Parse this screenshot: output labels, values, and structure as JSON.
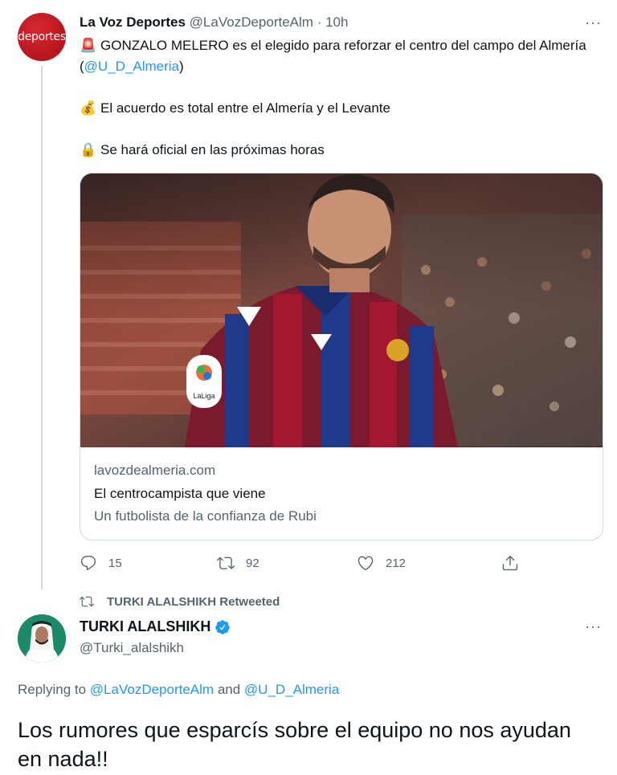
{
  "tweet1": {
    "avatar_text": "deportes",
    "name": "La Voz Deportes",
    "handle": "@LaVozDeporteAlm",
    "dot": "·",
    "time": "10h",
    "more": "···",
    "line1_emoji": "🚨",
    "line1_text": "GONZALO MELERO es el elegido para reforzar el centro del campo del Almería (",
    "line1_mention": "@U_D_Almeria",
    "line1_end": ")",
    "line2_emoji": "💰",
    "line2_text": "El acuerdo es total entre el Almería y el Levante",
    "line3_emoji": "🔒",
    "line3_text": "Se hará oficial en las próximas horas",
    "card": {
      "domain": "lavozdealmeria.com",
      "title": "El centrocampista que viene",
      "description": "Un futbolista de la confianza de Rubi",
      "badge_text": "LaLiga"
    },
    "actions": {
      "replies": "15",
      "retweets": "92",
      "likes": "212"
    }
  },
  "retweet_label": "TURKI ALALSHIKH Retweeted",
  "tweet2": {
    "name": "TURKI ALALSHIKH",
    "handle": "@Turki_alalshikh",
    "more": "···",
    "replying_prefix": "Replying to",
    "replying_user1": "@LaVozDeporteAlm",
    "replying_and": "and",
    "replying_user2": "@U_D_Almeria",
    "text": "Los rumores que esparcís sobre el equipo no nos ayudan en nada!!"
  },
  "colors": {
    "accent": "#1d9bf0",
    "muted": "#536471",
    "text": "#0f1419",
    "border": "#cfd9de",
    "avatar_red": "#c41e25"
  }
}
